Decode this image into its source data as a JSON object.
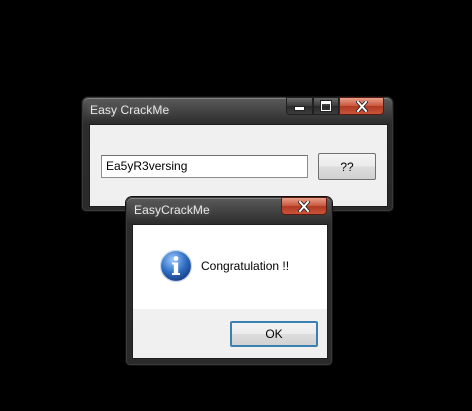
{
  "main_window": {
    "title": "Easy CrackMe",
    "input_value": "Ea5yR3versing",
    "check_button": "??"
  },
  "dialog": {
    "title": "EasyCrackMe",
    "message": "Congratulation !!",
    "ok_button": "OK"
  },
  "icons": {
    "minimize": "minimize-icon",
    "maximize": "maximize-icon",
    "close": "close-icon",
    "info": "info-icon"
  },
  "colors": {
    "desktop": "#000000",
    "dialog_client": "#ffffff",
    "dialog_footer": "#f0f0f0",
    "close_button": "#c8553b",
    "info_icon": "#2f6fc4"
  }
}
